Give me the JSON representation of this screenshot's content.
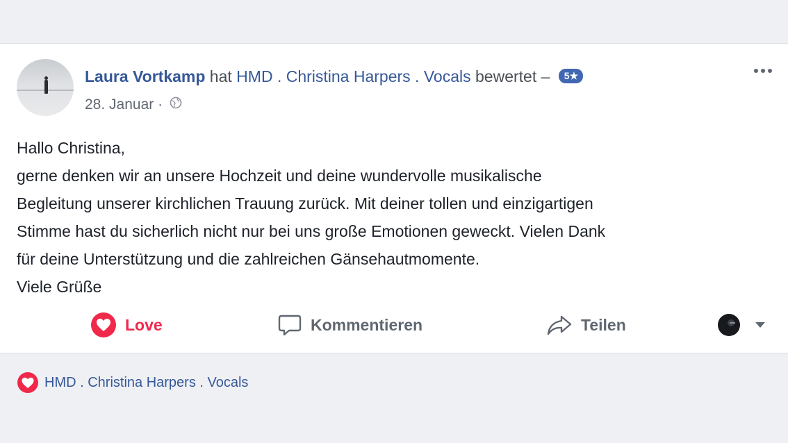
{
  "post": {
    "author": "Laura Vortkamp",
    "action_text": "hat",
    "page_name": "HMD . Christina Harpers . Vocals",
    "verb": "bewertet –",
    "rating": "5★",
    "date": "28. Januar",
    "date_separator": "·",
    "body_lines": [
      "Hallo Christina,",
      "gerne denken wir an unsere Hochzeit und deine wundervolle musikalische",
      "Begleitung unserer kirchlichen Trauung zurück. Mit deiner tollen und einzigartigen",
      "Stimme hast du sicherlich nicht nur bei uns große Emotionen geweckt. Vielen Dank",
      "für deine Unterstützung und die zahlreichen Gänsehautmomente.",
      "Viele Grüße"
    ]
  },
  "actions": {
    "love_label": "Love",
    "comment_label": "Kommentieren",
    "share_label": "Teilen"
  },
  "reactions": {
    "label": "HMD . Christina Harpers . Vocals"
  },
  "colors": {
    "link": "#365899",
    "love": "#f0284a",
    "badge": "#4267b2",
    "background": "#eef0f3"
  },
  "icons": [
    "more-icon",
    "globe-icon",
    "heart-icon",
    "comment-icon",
    "share-icon",
    "avatar-icon",
    "chevron-down-icon"
  ]
}
